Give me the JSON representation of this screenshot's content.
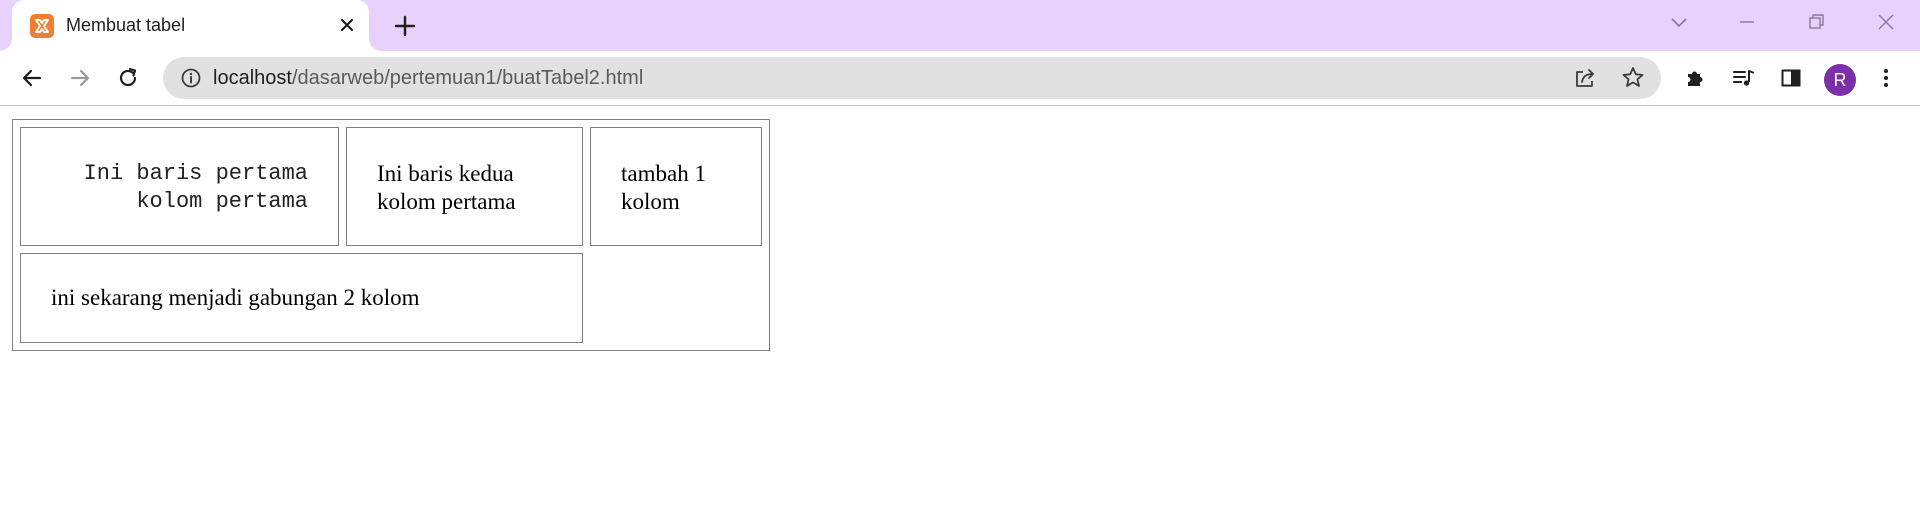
{
  "browser": {
    "tab": {
      "title": "Membuat tabel",
      "favicon": "xampp-icon"
    },
    "omnibox": {
      "url_host": "localhost",
      "url_path": "/dasarweb/pertemuan1/buatTabel2.html"
    },
    "profile_initial": "R",
    "colors": {
      "tabstrip": "#e8d1fd",
      "omnibox": "#e1e1e1",
      "avatar": "#7b2fa8",
      "favicon": "#f07f32"
    }
  },
  "page": {
    "table": {
      "row1": {
        "cell1_line1": "Ini baris pertama",
        "cell1_line2": "kolom pertama",
        "cell2_line1": "Ini baris kedua",
        "cell2_line2": "kolom pertama",
        "cell3_line1": "tambah 1",
        "cell3_line2": "kolom"
      },
      "row2": {
        "merged_cell": "ini sekarang menjadi gabungan 2 kolom"
      }
    }
  }
}
